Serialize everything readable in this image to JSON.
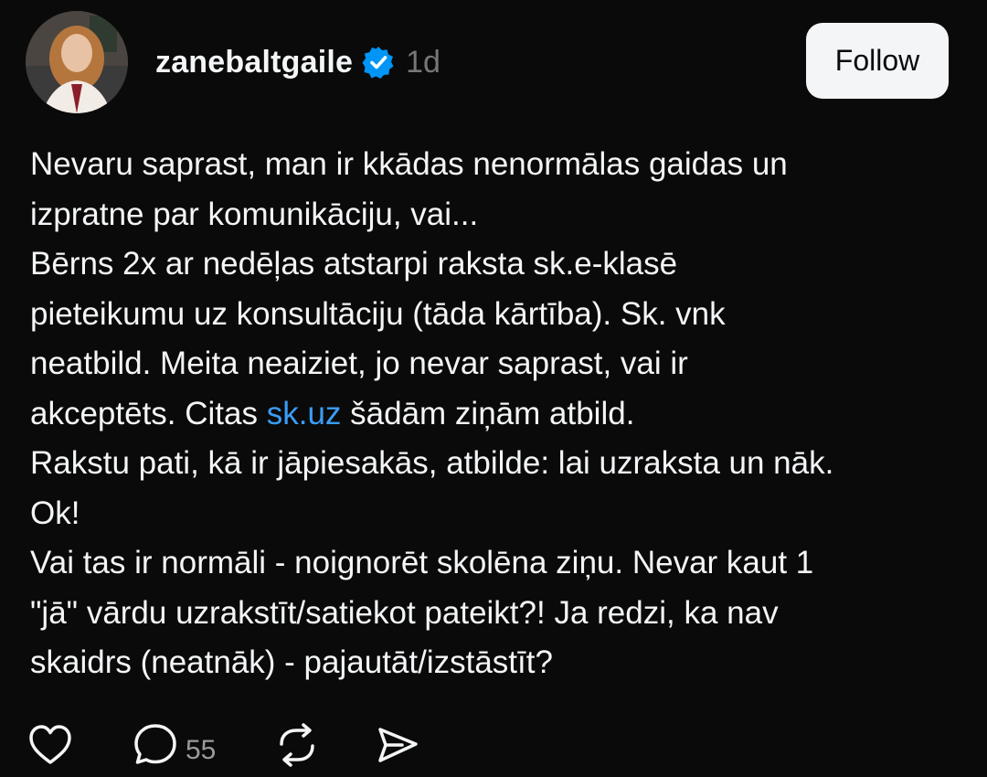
{
  "post": {
    "username": "zanebaltgaile",
    "verified": true,
    "timestamp": "1d",
    "follow_label": "Follow",
    "lines": {
      "l1": "Nevaru saprast, man ir kkādas nenormālas gaidas un",
      "l2": "izpratne par komunikāciju, vai...",
      "l3": "Bērns 2x ar nedēļas atstarpi raksta sk.e-klasē",
      "l4": "pieteikumu uz konsultāciju (tāda kārtība). Sk. vnk",
      "l5": "neatbild. Meita neaiziet, jo nevar saprast, vai ir",
      "l6_pre": "akceptēts. Citas ",
      "l6_link": "sk.uz",
      "l6_post": " šādām ziņām atbild.",
      "l7": "Rakstu pati, kā ir jāpiesakās, atbilde: lai uzraksta un nāk.",
      "l8": "Ok!",
      "l9": "Vai tas ir normāli - noignorēt skolēna ziņu. Nevar kaut 1",
      "l10": "\"jā\" vārdu uzrakstīt/satiekot pateikt?! Ja redzi, ka nav",
      "l11": "skaidrs (neatnāk) - pajautāt/izstāstīt?"
    }
  },
  "actions": {
    "reply_count": "55"
  },
  "colors": {
    "background": "#0a0a0a",
    "text": "#f3f5f7",
    "muted": "#777777",
    "link": "#3a9df8",
    "verified_badge": "#0095f6",
    "follow_button_bg": "#f3f5f7"
  },
  "icons": {
    "verified": "verified-badge-icon",
    "like": "heart-icon",
    "reply": "comment-icon",
    "repost": "repost-icon",
    "share": "send-icon"
  }
}
